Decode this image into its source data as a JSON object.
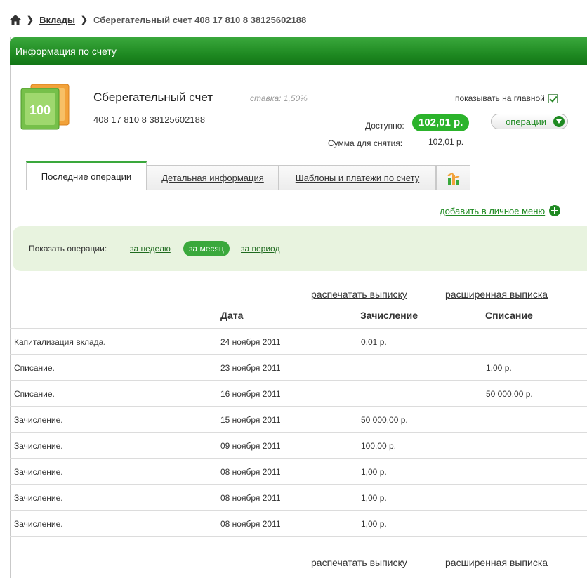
{
  "breadcrumb": {
    "link": "Вклады",
    "current": "Сберегательный счет 408 17 810 8 38125602188"
  },
  "panel": {
    "title": "Информация по счету"
  },
  "account": {
    "name": "Сберегательный счет",
    "rate": "ставка: 1,50%",
    "number": "408 17 810 8 38125602188",
    "show_on_main_label": "показывать на главной",
    "show_on_main_checked": true,
    "available_label": "Доступно:",
    "available_value": "102,01 р.",
    "operations_button": "операции",
    "withdraw_label": "Сумма для снятия:",
    "withdraw_value": "102,01 р."
  },
  "tabs": [
    {
      "label": "Последние операции",
      "active": true
    },
    {
      "label": "Детальная информация",
      "active": false
    },
    {
      "label": "Шаблоны и платежи по счету",
      "active": false
    },
    {
      "label": "",
      "icon": "chart-icon",
      "active": false
    }
  ],
  "add_menu_label": "добавить в личное меню",
  "filter": {
    "label": "Показать операции:",
    "options": [
      "за неделю",
      "за месяц",
      "за период"
    ],
    "selected": "за месяц"
  },
  "print_label": "распечатать выписку",
  "extended_label": "расширенная выписка",
  "table": {
    "headers": [
      "",
      "Дата",
      "Зачисление",
      "Списание"
    ],
    "rows": [
      [
        "Капитализация вклада.",
        "24 ноября 2011",
        "0,01 р.",
        ""
      ],
      [
        "Списание.",
        "23 ноября 2011",
        "",
        "1,00 р."
      ],
      [
        "Списание.",
        "16 ноября 2011",
        "",
        "50 000,00 р."
      ],
      [
        "Зачисление.",
        "15 ноября 2011",
        "50 000,00 р.",
        ""
      ],
      [
        "Зачисление.",
        "09 ноября 2011",
        "100,00 р.",
        ""
      ],
      [
        "Зачисление.",
        "08 ноября 2011",
        "1,00 р.",
        ""
      ],
      [
        "Зачисление.",
        "08 ноября 2011",
        "1,00 р.",
        ""
      ],
      [
        "Зачисление.",
        "08 ноября 2011",
        "1,00 р.",
        ""
      ]
    ]
  },
  "colors": {
    "brand_green": "#1f8a22",
    "pill_green": "#2bb32b",
    "filter_bg": "#e8f3df"
  }
}
